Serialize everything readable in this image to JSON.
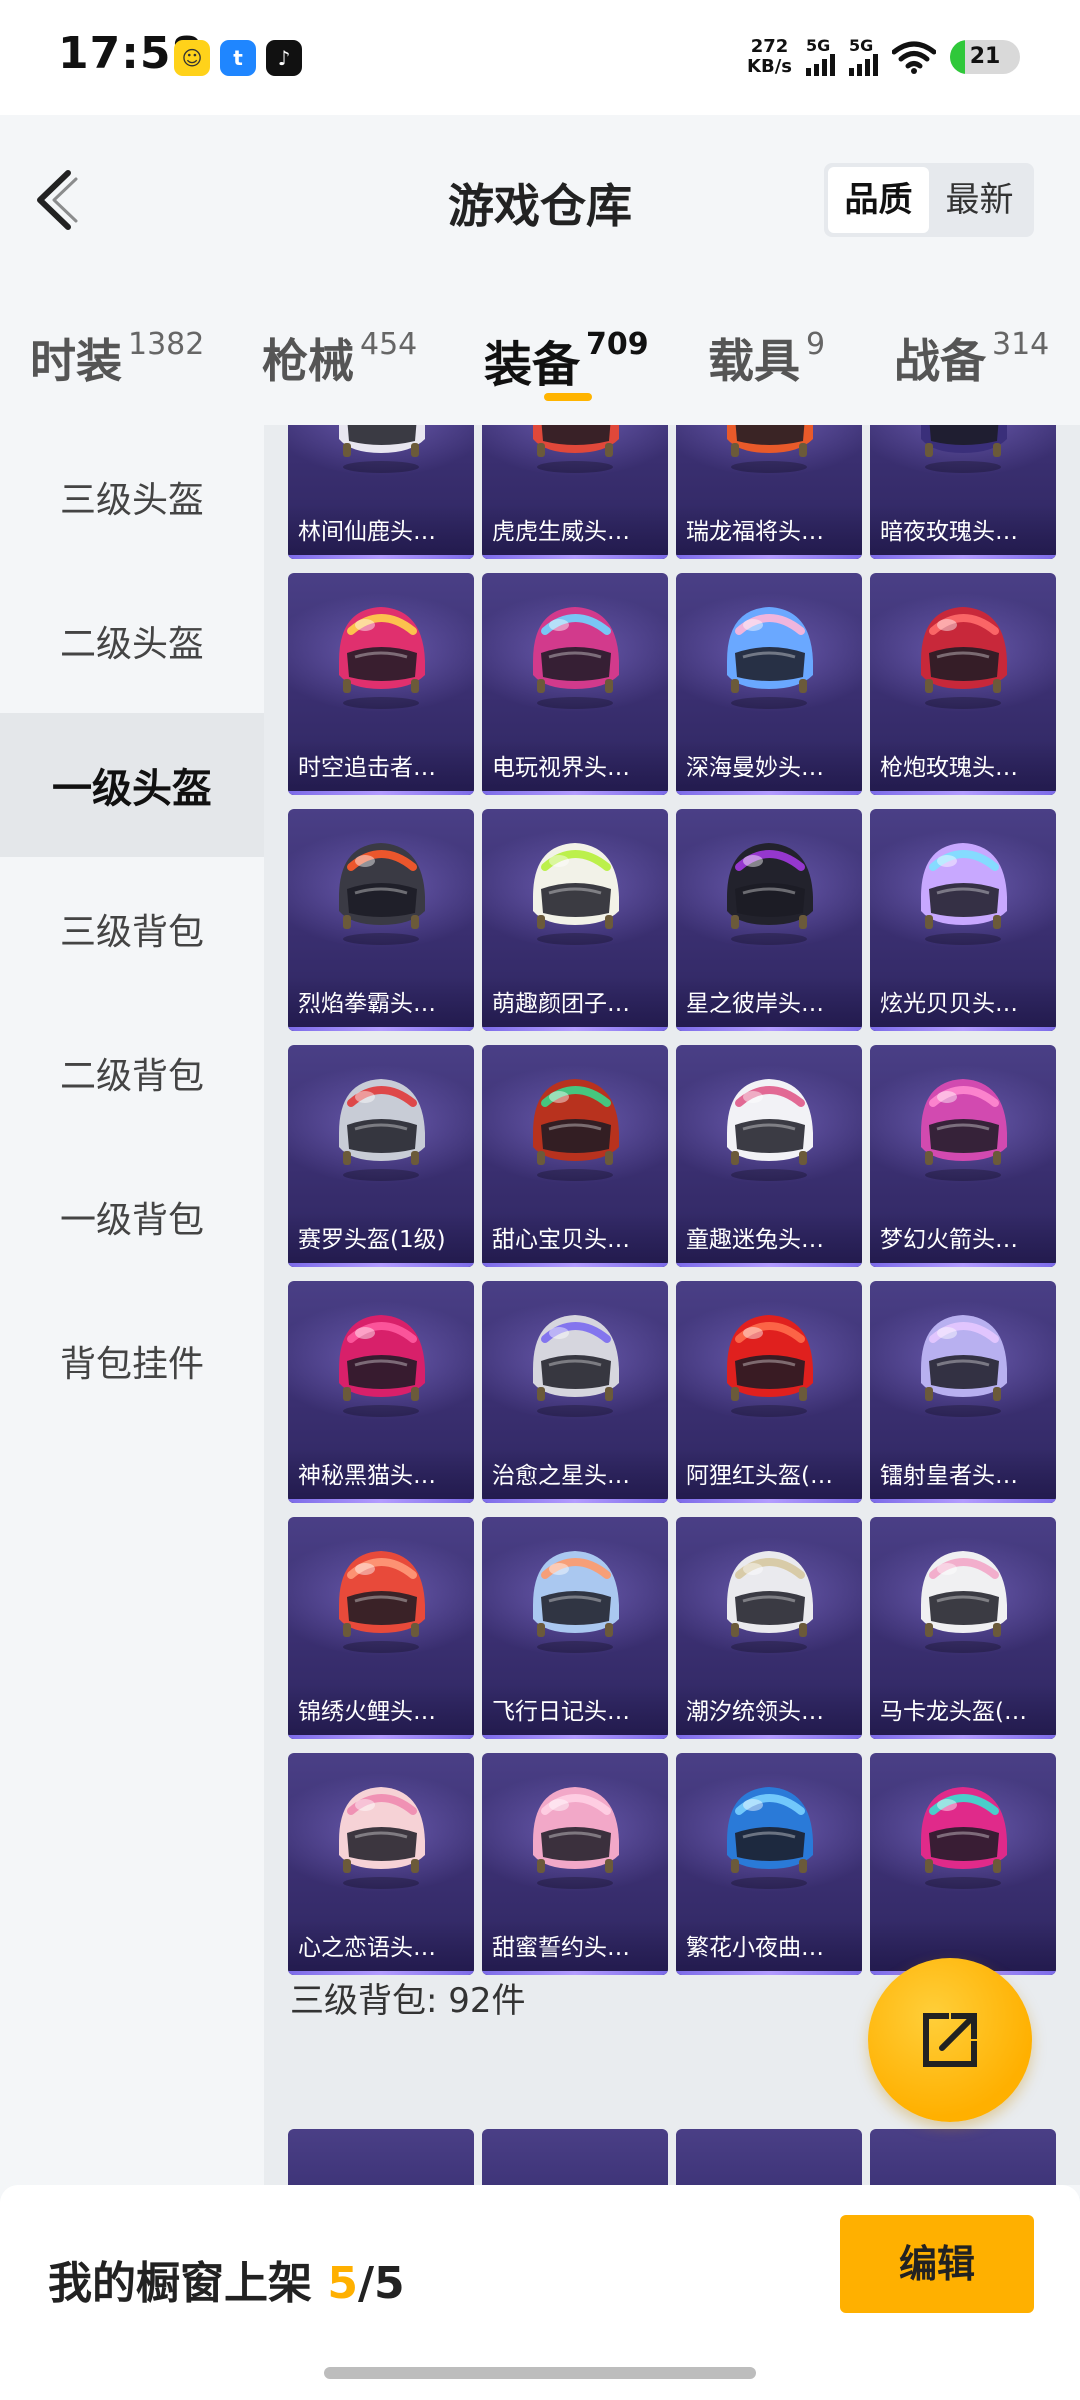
{
  "status_bar": {
    "time": "17:58",
    "speed_value": "272",
    "speed_unit": "KB/s",
    "signal1_label": "5G",
    "signal2_label": "5G",
    "battery_percent": "21",
    "apps": [
      {
        "icon": "app-yellow-icon",
        "color": "#ffd21a"
      },
      {
        "icon": "app-blue-icon",
        "color": "#1f86ff"
      },
      {
        "icon": "tiktok-icon",
        "color": "#111111"
      }
    ]
  },
  "header": {
    "title": "游戏仓库",
    "sort_options": [
      "品质",
      "最新"
    ],
    "sort_selected": "品质"
  },
  "categories": [
    {
      "name": "时装",
      "count": "1382"
    },
    {
      "name": "枪械",
      "count": "454"
    },
    {
      "name": "装备",
      "count": "709"
    },
    {
      "name": "载具",
      "count": "9"
    },
    {
      "name": "战备",
      "count": "314"
    }
  ],
  "active_category": "装备",
  "sidebar": {
    "items": [
      "三级头盔",
      "二级头盔",
      "一级头盔",
      "三级背包",
      "二级背包",
      "一级背包",
      "背包挂件"
    ],
    "active": "一级头盔"
  },
  "items": [
    {
      "label": "林间仙鹿头…",
      "color": "#e8e6f0",
      "accent": "#ff7fb0"
    },
    {
      "label": "虎虎生威头…",
      "color": "#e0483a",
      "accent": "#f3f0e8"
    },
    {
      "label": "瑞龙福将头…",
      "color": "#e85a2a",
      "accent": "#f6e9d8"
    },
    {
      "label": "暗夜玫瑰头…",
      "color": "#3a2f7a",
      "accent": "#9a7df0"
    },
    {
      "label": "时空追击者…",
      "color": "#e0306e",
      "accent": "#ffd34a"
    },
    {
      "label": "电玩视界头…",
      "color": "#d23a8c",
      "accent": "#6fd6ff"
    },
    {
      "label": "深海曼妙头…",
      "color": "#6aa8ff",
      "accent": "#ffb6d9"
    },
    {
      "label": "枪炮玫瑰头…",
      "color": "#c8283a",
      "accent": "#ff6b6b"
    },
    {
      "label": "烈焰拳霸头…",
      "color": "#3a3a44",
      "accent": "#ff5a2a"
    },
    {
      "label": "萌趣颜团子…",
      "color": "#f2f2e8",
      "accent": "#b6f03a"
    },
    {
      "label": "星之彼岸头…",
      "color": "#22222c",
      "accent": "#a23ae0"
    },
    {
      "label": "炫光贝贝头…",
      "color": "#c8a8ff",
      "accent": "#7de0ff"
    },
    {
      "label": "赛罗头盔(1级)",
      "color": "#c8ccd6",
      "accent": "#e03a3a"
    },
    {
      "label": "甜心宝贝头…",
      "color": "#b8321e",
      "accent": "#3ad68a"
    },
    {
      "label": "童趣迷兔头…",
      "color": "#f2f2f6",
      "accent": "#e05a8a"
    },
    {
      "label": "梦幻火箭头…",
      "color": "#d24ab0",
      "accent": "#ff8ad0"
    },
    {
      "label": "神秘黑猫头…",
      "color": "#d8206a",
      "accent": "#ff5aa0"
    },
    {
      "label": "治愈之星头…",
      "color": "#d6d6de",
      "accent": "#7a6af0"
    },
    {
      "label": "阿狸红头盔(…",
      "color": "#e0201e",
      "accent": "#ff6b4a"
    },
    {
      "label": "镭射皇者头…",
      "color": "#b8b0f0",
      "accent": "#e6c8ff"
    },
    {
      "label": "锦绣火鲤头…",
      "color": "#e84a3a",
      "accent": "#ff9a7a"
    },
    {
      "label": "飞行日记头…",
      "color": "#aac8f0",
      "accent": "#ff9a6a"
    },
    {
      "label": "潮汐统领头…",
      "color": "#eaeaee",
      "accent": "#d6c8a0"
    },
    {
      "label": "马卡龙头盔(…",
      "color": "#f0f0f2",
      "accent": "#f2a6c8"
    },
    {
      "label": "心之恋语头…",
      "color": "#f6d2d6",
      "accent": "#f08ab0"
    },
    {
      "label": "甜蜜誓约头…",
      "color": "#f2a8c8",
      "accent": "#ffd0e4"
    },
    {
      "label": "繁花小夜曲…",
      "color": "#2a7ad8",
      "accent": "#7ad0ff"
    },
    {
      "label": "",
      "color": "#e02a8a",
      "accent": "#3ae0d0"
    }
  ],
  "section_title": "三级背包: 92件",
  "bottom_bar": {
    "shelf_label": "我的橱窗上架",
    "shelf_used": "5",
    "shelf_total": "/5",
    "edit_label": "编辑"
  }
}
